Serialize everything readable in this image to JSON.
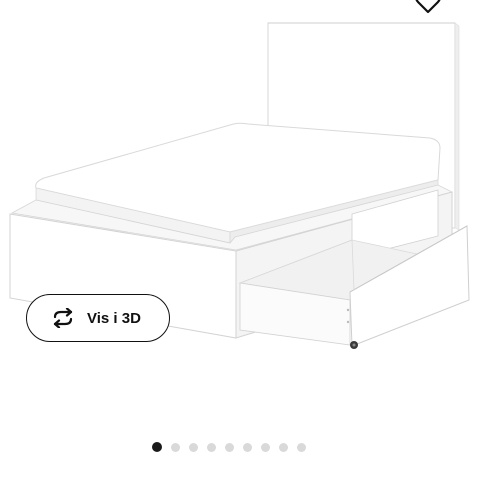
{
  "product_viewer": {
    "image_icon": "bed-with-drawer-image",
    "view_3d": {
      "label": "Vis i 3D",
      "icon": "rotate-3d-icon"
    },
    "wishlist_icon": "heart-icon",
    "carousel": {
      "total": 9,
      "active_index": 0
    },
    "colors": {
      "active_dot": "#1a1a1a",
      "inactive_dot": "#d9d9d9",
      "button_border": "#111111"
    }
  }
}
